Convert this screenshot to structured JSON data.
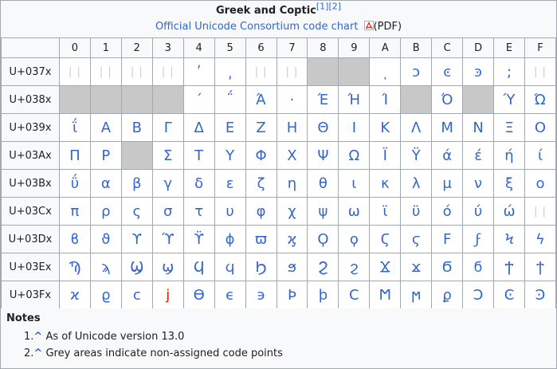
{
  "caption": {
    "title": "Greek and Coptic",
    "refs": "[1][2]",
    "link": "Official Unicode Consortium code chart",
    "pdf": "(PDF)"
  },
  "columns": [
    "0",
    "1",
    "2",
    "3",
    "4",
    "5",
    "6",
    "7",
    "8",
    "9",
    "A",
    "B",
    "C",
    "D",
    "E",
    "F"
  ],
  "rows": [
    {
      "label": "U+037x",
      "cells": [
        {
          "t": "| |",
          "k": "np"
        },
        {
          "t": "| |",
          "k": "np"
        },
        {
          "t": "| |",
          "k": "np"
        },
        {
          "t": "| |",
          "k": "np"
        },
        {
          "t": "ʹ"
        },
        {
          "t": "͵"
        },
        {
          "t": "| |",
          "k": "np"
        },
        {
          "t": "| |",
          "k": "np"
        },
        {
          "t": "",
          "k": "na"
        },
        {
          "t": "",
          "k": "na"
        },
        {
          "t": "ͺ"
        },
        {
          "t": "ͻ"
        },
        {
          "t": "ͼ"
        },
        {
          "t": "ͽ"
        },
        {
          "t": ";"
        },
        {
          "t": "| |",
          "k": "np"
        }
      ]
    },
    {
      "label": "U+038x",
      "cells": [
        {
          "t": "",
          "k": "na"
        },
        {
          "t": "",
          "k": "na"
        },
        {
          "t": "",
          "k": "na"
        },
        {
          "t": "",
          "k": "na"
        },
        {
          "t": "΄"
        },
        {
          "t": "΅"
        },
        {
          "t": "Ά"
        },
        {
          "t": "·"
        },
        {
          "t": "Έ"
        },
        {
          "t": "Ή"
        },
        {
          "t": "Ί"
        },
        {
          "t": "",
          "k": "na"
        },
        {
          "t": "Ό"
        },
        {
          "t": "",
          "k": "na"
        },
        {
          "t": "Ύ"
        },
        {
          "t": "Ώ"
        }
      ]
    },
    {
      "label": "U+039x",
      "cells": [
        {
          "t": "ΐ"
        },
        {
          "t": "Α"
        },
        {
          "t": "Β"
        },
        {
          "t": "Γ"
        },
        {
          "t": "Δ"
        },
        {
          "t": "Ε"
        },
        {
          "t": "Ζ"
        },
        {
          "t": "Η"
        },
        {
          "t": "Θ"
        },
        {
          "t": "Ι"
        },
        {
          "t": "Κ"
        },
        {
          "t": "Λ"
        },
        {
          "t": "Μ"
        },
        {
          "t": "Ν"
        },
        {
          "t": "Ξ"
        },
        {
          "t": "Ο"
        }
      ]
    },
    {
      "label": "U+03Ax",
      "cells": [
        {
          "t": "Π"
        },
        {
          "t": "Ρ"
        },
        {
          "t": "",
          "k": "na"
        },
        {
          "t": "Σ"
        },
        {
          "t": "Τ"
        },
        {
          "t": "Υ"
        },
        {
          "t": "Φ"
        },
        {
          "t": "Χ"
        },
        {
          "t": "Ψ"
        },
        {
          "t": "Ω"
        },
        {
          "t": "Ϊ"
        },
        {
          "t": "Ϋ"
        },
        {
          "t": "ά"
        },
        {
          "t": "έ"
        },
        {
          "t": "ή"
        },
        {
          "t": "ί"
        }
      ]
    },
    {
      "label": "U+03Bx",
      "cells": [
        {
          "t": "ΰ"
        },
        {
          "t": "α"
        },
        {
          "t": "β"
        },
        {
          "t": "γ"
        },
        {
          "t": "δ"
        },
        {
          "t": "ε"
        },
        {
          "t": "ζ"
        },
        {
          "t": "η"
        },
        {
          "t": "θ"
        },
        {
          "t": "ι"
        },
        {
          "t": "κ"
        },
        {
          "t": "λ"
        },
        {
          "t": "μ"
        },
        {
          "t": "ν"
        },
        {
          "t": "ξ"
        },
        {
          "t": "ο"
        }
      ]
    },
    {
      "label": "U+03Cx",
      "cells": [
        {
          "t": "π"
        },
        {
          "t": "ρ"
        },
        {
          "t": "ς"
        },
        {
          "t": "σ"
        },
        {
          "t": "τ"
        },
        {
          "t": "υ"
        },
        {
          "t": "φ"
        },
        {
          "t": "χ"
        },
        {
          "t": "ψ"
        },
        {
          "t": "ω"
        },
        {
          "t": "ϊ"
        },
        {
          "t": "ϋ"
        },
        {
          "t": "ό"
        },
        {
          "t": "ύ"
        },
        {
          "t": "ώ"
        },
        {
          "t": "| |",
          "k": "np"
        }
      ]
    },
    {
      "label": "U+03Dx",
      "cells": [
        {
          "t": "ϐ"
        },
        {
          "t": "ϑ"
        },
        {
          "t": "ϒ"
        },
        {
          "t": "ϓ"
        },
        {
          "t": "ϔ"
        },
        {
          "t": "ϕ"
        },
        {
          "t": "ϖ"
        },
        {
          "t": "ϗ"
        },
        {
          "t": "Ϙ"
        },
        {
          "t": "ϙ"
        },
        {
          "t": "Ϛ"
        },
        {
          "t": "ϛ"
        },
        {
          "t": "Ϝ"
        },
        {
          "t": "ϝ"
        },
        {
          "t": "Ϟ"
        },
        {
          "t": "ϟ"
        }
      ]
    },
    {
      "label": "U+03Ex",
      "cells": [
        {
          "t": "Ϡ"
        },
        {
          "t": "ϡ"
        },
        {
          "t": "Ϣ"
        },
        {
          "t": "ϣ"
        },
        {
          "t": "Ϥ"
        },
        {
          "t": "ϥ"
        },
        {
          "t": "Ϧ"
        },
        {
          "t": "ϧ"
        },
        {
          "t": "Ϩ"
        },
        {
          "t": "ϩ"
        },
        {
          "t": "Ϫ"
        },
        {
          "t": "ϫ"
        },
        {
          "t": "Ϭ"
        },
        {
          "t": "ϭ"
        },
        {
          "t": "Ϯ"
        },
        {
          "t": "ϯ"
        }
      ]
    },
    {
      "label": "U+03Fx",
      "cells": [
        {
          "t": "ϰ"
        },
        {
          "t": "ϱ"
        },
        {
          "t": "ϲ"
        },
        {
          "t": "ϳ",
          "k": "red"
        },
        {
          "t": "ϴ"
        },
        {
          "t": "ϵ"
        },
        {
          "t": "϶"
        },
        {
          "t": "Ϸ"
        },
        {
          "t": "ϸ"
        },
        {
          "t": "Ϲ"
        },
        {
          "t": "Ϻ"
        },
        {
          "t": "ϻ"
        },
        {
          "t": "ϼ"
        },
        {
          "t": "Ͻ"
        },
        {
          "t": "Ͼ"
        },
        {
          "t": "Ͽ"
        }
      ]
    }
  ],
  "notes": {
    "title": "Notes",
    "items": [
      {
        "num": "1.",
        "arrow": "^",
        "text": "As of Unicode version 13.0"
      },
      {
        "num": "2.",
        "arrow": "^",
        "text": "Grey areas indicate non-assigned code points"
      }
    ]
  },
  "colors": {
    "link": "#3366cc",
    "unassigned": "#c8c8c8",
    "border": "#a2a9b1",
    "header_bg": "#f8f9fa"
  },
  "icons": {
    "pdf": "pdf-icon"
  }
}
